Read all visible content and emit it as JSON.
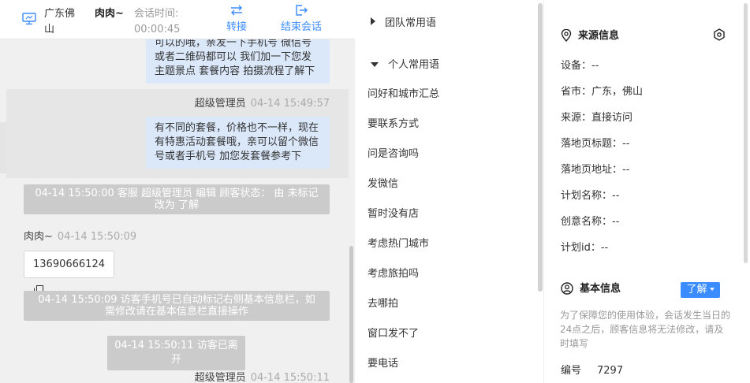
{
  "header": {
    "location": "广东佛山",
    "visitor_name": "肉肉~",
    "session_time_label": "会话时间:",
    "session_time_value": "00:00:45",
    "transfer_label": "转接",
    "end_label": "结束会话",
    "accent_color": "#3b8cff"
  },
  "chat": {
    "message_1_text": "可以的哦，亲发一下手机号 微信号或者二维码都可以 我们加一下您发主题景点 套餐内容 拍摄流程了解下",
    "message_2_sender": "超级管理员",
    "message_2_time": "04-14 15:49:57",
    "message_2_text": "有不同的套餐，价格也不一样，现在有特惠活动套餐哦，亲可以留个微信号或者手机号 加您发套餐参考下",
    "system_1": "04-14 15:50:00 客服 超级管理员 编辑 顾客状态： 由 未标记 改为 了解",
    "visitor_sender": "肉肉~",
    "visitor_time": "04-14 15:50:09",
    "visitor_phone": "13690666124",
    "system_2": "04-14 15:50:09 访客手机号已自动标记右侧基本信息栏，如需修改请在基本信息栏直接操作",
    "system_3": "04-14 15:50:11 访客已离开",
    "message_3_sender": "超级管理员",
    "message_3_time": "04-14 15:50:11"
  },
  "phrases": {
    "team_group": "团队常用语",
    "personal_group": "个人常用语",
    "items": [
      "问好和城市汇总",
      "要联系方式",
      "问是咨询吗",
      "发微信",
      "暂时没有店",
      "考虑热门城市",
      "考虑旅拍吗",
      "去哪拍",
      "窗口发不了",
      "要电话"
    ]
  },
  "source_info": {
    "title": "来源信息",
    "rows": [
      "设备：--",
      "省市：广东，佛山",
      "来源：直接访问",
      "落地页标题：--",
      "落地页地址：--",
      "计划名称：--",
      "创意名称：--",
      "计划id：--"
    ]
  },
  "basic_info": {
    "title": "基本信息",
    "status_button": "了解",
    "notice": "为了保障您的使用体验，会话发生当日的24点之后，顾客信息将无法修改，请及时填写",
    "id_label": "编号",
    "id_value": "7297"
  },
  "icons": {
    "monitor": "monitor-icon",
    "transfer": "transfer-icon",
    "end_session": "exit-icon",
    "copy": "copy-icon",
    "location": "location-pin-icon",
    "settings": "settings-icon",
    "user": "user-circle-icon"
  }
}
